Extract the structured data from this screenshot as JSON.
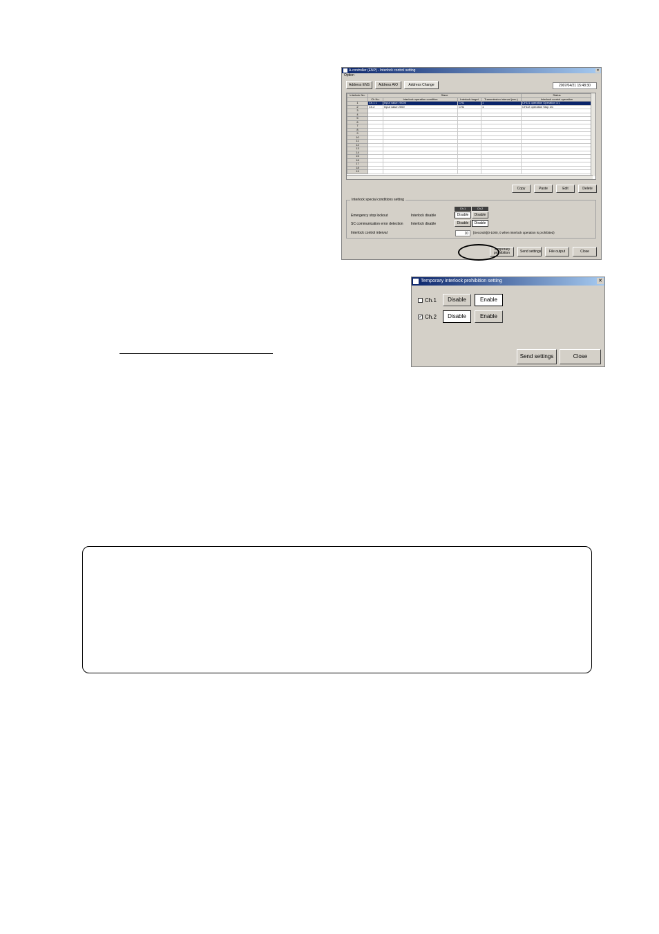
{
  "main_window": {
    "title": "A-controller (ENP) - Interlock control setting",
    "menu": "Option",
    "tabs": [
      "Address ENS",
      "Address AIO",
      "Address Change"
    ],
    "datetime": "2007/04/21 15:48:30",
    "table": {
      "headers_top": [
        "Interlock No.",
        "Slave",
        "",
        "",
        "",
        "Status"
      ],
      "headers": [
        "",
        "Ch No.",
        "Interlock operation condition",
        "Interlock target",
        "Transmission interval (sec.)",
        "Interlock control operation"
      ],
      "rows": [
        {
          "no": "1",
          "ch": "Ch.1 1",
          "cond": "Input value >5000",
          "target": "CH1",
          "interval": "1",
          "op": "CH1/1 operation Operation 1/1",
          "selected": true
        },
        {
          "no": "2",
          "ch": "Ch.2",
          "cond": "Input value 2000",
          "target": "CH1",
          "interval": "1",
          "op": "CH1/2 operation Stop 2/1",
          "selected": false
        },
        {
          "no": "3"
        },
        {
          "no": "4"
        },
        {
          "no": "5"
        },
        {
          "no": "6"
        },
        {
          "no": "7"
        },
        {
          "no": "8"
        },
        {
          "no": "9"
        },
        {
          "no": "10"
        },
        {
          "no": "11"
        },
        {
          "no": "12"
        },
        {
          "no": "13"
        },
        {
          "no": "14"
        },
        {
          "no": "15"
        },
        {
          "no": "16"
        },
        {
          "no": "17"
        },
        {
          "no": "18"
        },
        {
          "no": "19"
        }
      ]
    },
    "grid_buttons": [
      "Copy",
      "Paste",
      "Edit",
      "Delete"
    ],
    "special": {
      "title": "Interlock special conditions setting",
      "ch_headers": [
        "Ch.1",
        "Ch.2"
      ],
      "row1_label": "Emergency stop lockout",
      "row1_sub": "Interlock disable",
      "row2_label": "SC communication error detection",
      "row2_sub": "Interlock disable",
      "disable": "Disable",
      "interval_label": "Interlock control interval",
      "interval_value": "10",
      "interval_note": "[Seconds](0-1000, 0 when interlock operation is prohibited)"
    },
    "bottom_buttons": {
      "temp_line1": "Temporary",
      "temp_line2": "prohibition",
      "send": "Send settings",
      "file": "File output",
      "close": "Close"
    }
  },
  "dialog": {
    "title": "Temporary interlock prohibition setting",
    "ch1_label": "Ch.1",
    "ch2_label": "Ch.2",
    "ch1_checked": false,
    "ch2_checked": true,
    "disable": "Disable",
    "enable": "Enable",
    "send": "Send settings",
    "close": "Close"
  }
}
